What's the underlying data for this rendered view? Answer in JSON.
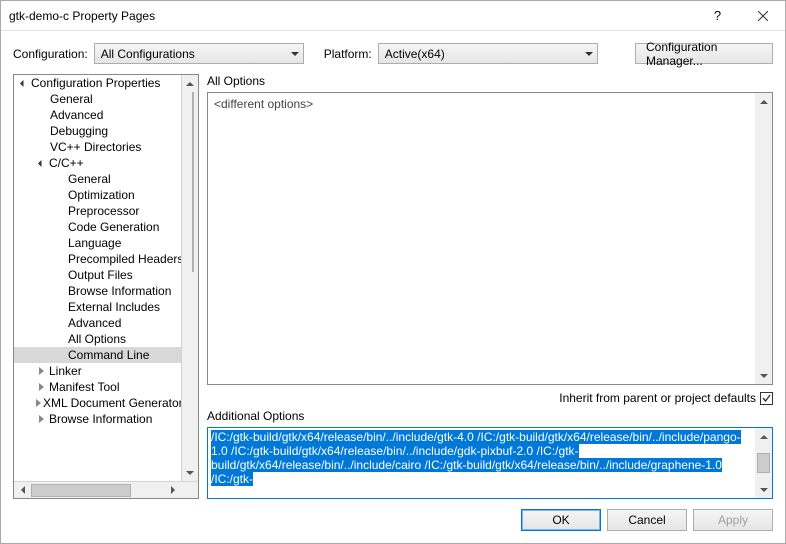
{
  "window": {
    "title": "gtk-demo-c Property Pages"
  },
  "toolbar": {
    "configuration_label": "Configuration:",
    "configuration_value": "All Configurations",
    "platform_label": "Platform:",
    "platform_value": "Active(x64)",
    "config_manager": "Configuration Manager..."
  },
  "tree": {
    "root": "Configuration Properties",
    "items": [
      "General",
      "Advanced",
      "Debugging",
      "VC++ Directories"
    ],
    "cpp": {
      "label": "C/C++",
      "children": [
        "General",
        "Optimization",
        "Preprocessor",
        "Code Generation",
        "Language",
        "Precompiled Headers",
        "Output Files",
        "Browse Information",
        "External Includes",
        "Advanced",
        "All Options",
        "Command Line"
      ]
    },
    "rest": [
      "Linker",
      "Manifest Tool",
      "XML Document Generator",
      "Browse Information"
    ]
  },
  "right": {
    "all_options_label": "All Options",
    "all_options_value": "<different options>",
    "inherit_label": "Inherit from parent or project defaults",
    "inherit_checked": true,
    "additional_label": "Additional Options",
    "additional_text": "/IC:/gtk-build/gtk/x64/release/bin/../include/gtk-4.0 /IC:/gtk-build/gtk/x64/release/bin/../include/pango-1.0 /IC:/gtk-build/gtk/x64/release/bin/../include/gdk-pixbuf-2.0 /IC:/gtk-build/gtk/x64/release/bin/../include/cairo /IC:/gtk-build/gtk/x64/release/bin/../include/graphene-1.0 /IC:/gtk-"
  },
  "footer": {
    "ok": "OK",
    "cancel": "Cancel",
    "apply": "Apply"
  }
}
